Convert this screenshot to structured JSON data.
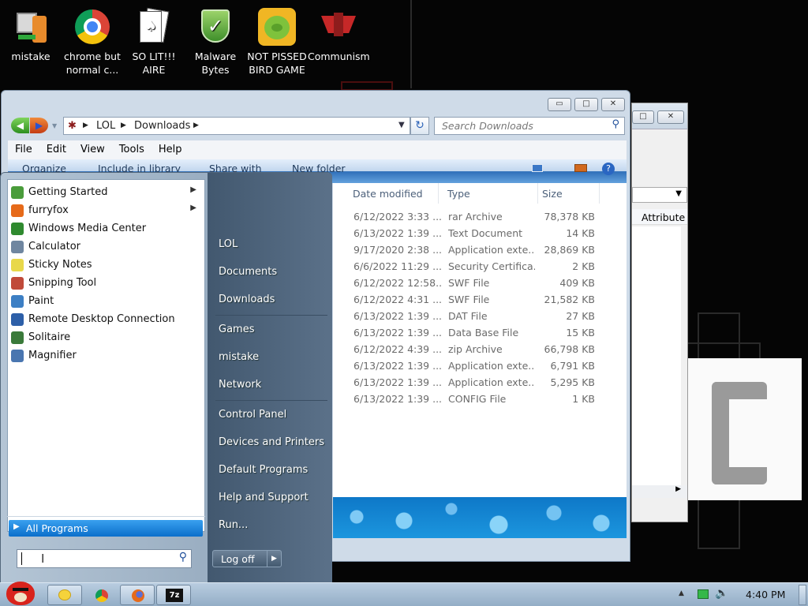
{
  "desktop": {
    "icons": [
      {
        "label": "mistake",
        "icon": "computer-user-icon"
      },
      {
        "label": "chrome but normal c...",
        "icon": "chrome-icon"
      },
      {
        "label": "SO LIT!!! AIRE",
        "icon": "solitaire-cards-icon"
      },
      {
        "label": "Malware Bytes",
        "icon": "shield-check-icon"
      },
      {
        "label": "NOT PISSED BIRD GAME",
        "icon": "green-pig-icon"
      },
      {
        "label": "Communism",
        "icon": "red-emblem-icon"
      }
    ]
  },
  "explorer": {
    "breadcrumb": [
      "LOL",
      "Downloads"
    ],
    "search_placeholder": "Search Downloads",
    "menu": [
      "File",
      "Edit",
      "View",
      "Tools",
      "Help"
    ],
    "commands": [
      "Organize",
      "Include in library",
      "Share with",
      "New folder"
    ],
    "columns": [
      "Date modified",
      "Type",
      "Size"
    ],
    "rows": [
      {
        "date": "6/12/2022 3:33 ...",
        "type": "rar Archive",
        "size": "78,378 KB"
      },
      {
        "date": "6/13/2022 1:39 ...",
        "type": "Text Document",
        "size": "14 KB"
      },
      {
        "date": "9/17/2020 2:38 ...",
        "type": "Application exte...",
        "size": "28,869 KB"
      },
      {
        "date": "6/6/2022 11:29 ...",
        "type": "Security Certifica...",
        "size": "2 KB"
      },
      {
        "date": "6/12/2022 12:58...",
        "type": "SWF File",
        "size": "409 KB"
      },
      {
        "date": "6/12/2022 4:31 ...",
        "type": "SWF File",
        "size": "21,582 KB"
      },
      {
        "date": "6/13/2022 1:39 ...",
        "type": "DAT File",
        "size": "27 KB"
      },
      {
        "date": "6/13/2022 1:39 ...",
        "type": "Data Base File",
        "size": "15 KB"
      },
      {
        "date": "6/12/2022 4:39 ...",
        "type": "zip Archive",
        "size": "66,798 KB"
      },
      {
        "date": "6/13/2022 1:39 ...",
        "type": "Application exte...",
        "size": "6,791 KB"
      },
      {
        "date": "6/13/2022 1:39 ...",
        "type": "Application exte...",
        "size": "5,295 KB"
      },
      {
        "date": "6/13/2022 1:39 ...",
        "type": "CONFIG File",
        "size": "1 KB"
      }
    ]
  },
  "back_window": {
    "column": "Attribute"
  },
  "start_menu": {
    "programs": [
      {
        "label": "Getting Started",
        "has_submenu": true,
        "icon": "getting-started-icon",
        "color": "#4a9c3b"
      },
      {
        "label": "furryfox",
        "has_submenu": true,
        "icon": "firefox-icon",
        "color": "#e66a1a"
      },
      {
        "label": "Windows Media Center",
        "has_submenu": false,
        "icon": "media-center-icon",
        "color": "#2f8a2f"
      },
      {
        "label": "Calculator",
        "has_submenu": false,
        "icon": "calculator-icon",
        "color": "#6f86a0"
      },
      {
        "label": "Sticky Notes",
        "has_submenu": false,
        "icon": "sticky-notes-icon",
        "color": "#e8d84a"
      },
      {
        "label": "Snipping Tool",
        "has_submenu": false,
        "icon": "scissors-icon",
        "color": "#c04a3a"
      },
      {
        "label": "Paint",
        "has_submenu": false,
        "icon": "paint-icon",
        "color": "#3d7fc4"
      },
      {
        "label": "Remote Desktop Connection",
        "has_submenu": false,
        "icon": "remote-desktop-icon",
        "color": "#2d5fa8"
      },
      {
        "label": "Solitaire",
        "has_submenu": false,
        "icon": "solitaire-icon",
        "color": "#3a7a3a"
      },
      {
        "label": "Magnifier",
        "has_submenu": false,
        "icon": "magnifier-icon",
        "color": "#4a76b0"
      }
    ],
    "all_programs": "All Programs",
    "right_items": [
      "LOL",
      "Documents",
      "Downloads",
      "Games",
      "mistake",
      "Network",
      "Control Panel",
      "Devices and Printers",
      "Default Programs",
      "Help and Support",
      "Run..."
    ],
    "log_off": "Log off"
  },
  "taskbar": {
    "clock": "4:40 PM",
    "pinned": [
      "angry-bird-start-icon",
      "file-manager-icon",
      "chrome-icon",
      "firefox-icon",
      "7zip-icon"
    ],
    "zip_label": "7z"
  }
}
